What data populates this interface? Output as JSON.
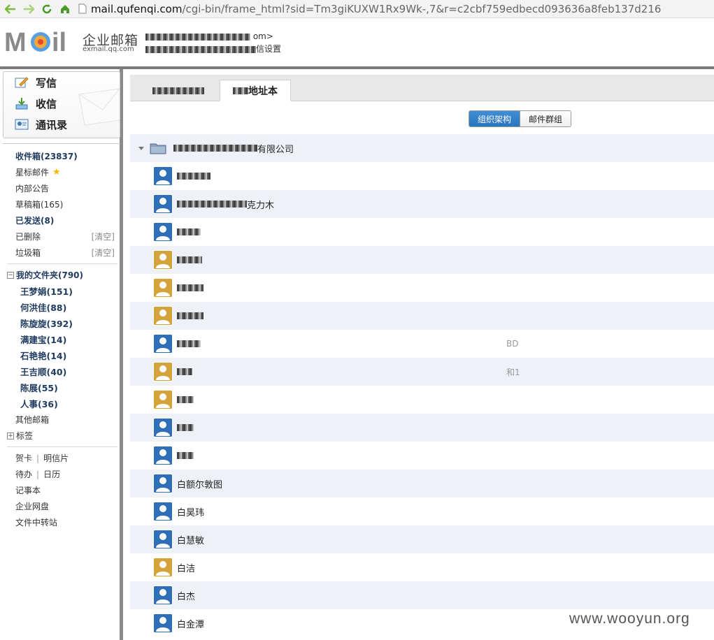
{
  "browser": {
    "url_host": "mail.qufenqi.com",
    "url_path": "/cgi-bin/frame_html?sid=Tm3giKUXW1Rx9Wk-,7&r=c2cbf759edbecd093636a8feb137d216"
  },
  "header": {
    "brand_name": "企业邮箱",
    "brand_domain": "exmail.qq.com",
    "account_suffix": "om>",
    "settings_suffix": "信设置"
  },
  "quick_actions": {
    "compose": "写信",
    "receive": "收信",
    "contacts": "通讯录"
  },
  "folders": {
    "inbox": "收件箱(23837)",
    "starred": "星标邮件",
    "announcements": "内部公告",
    "drafts": "草稿箱(165)",
    "sent": "已发送(8)",
    "deleted": "已删除",
    "spam": "垃圾箱",
    "clear_label": "[清空]",
    "my_folders": "我的文件夹(790)",
    "subfolders": [
      "王梦娟(151)",
      "何洪佳(88)",
      "陈旋旋(392)",
      "满建宝(14)",
      "石艳艳(14)",
      "王吉顺(40)",
      "陈展(55)",
      "人事(36)"
    ],
    "other_mailboxes": "其他邮箱",
    "tags": "标签"
  },
  "tools": {
    "card": "贺卡",
    "postcard": "明信片",
    "todo": "待办",
    "calendar": "日历",
    "notes": "记事本",
    "disk": "企业网盘",
    "transfer": "文件中转站"
  },
  "main": {
    "tab_personal": "",
    "tab_company": "地址本",
    "view_org": "组织架构",
    "view_groups": "邮件群组",
    "org_name": "有限公司",
    "contacts": [
      {
        "name": "",
        "dept": "",
        "avatar": "male"
      },
      {
        "name": "克力木",
        "dept": "",
        "avatar": "male"
      },
      {
        "name": "",
        "dept": "",
        "avatar": "male"
      },
      {
        "name": "",
        "dept": "",
        "avatar": "female"
      },
      {
        "name": "",
        "dept": "",
        "avatar": "female"
      },
      {
        "name": "",
        "dept": "",
        "avatar": "female"
      },
      {
        "name": "",
        "dept": "BD",
        "avatar": "male"
      },
      {
        "name": "",
        "dept": "和1",
        "avatar": "female"
      },
      {
        "name": "",
        "dept": "",
        "avatar": "female"
      },
      {
        "name": "",
        "dept": "",
        "avatar": "male"
      },
      {
        "name": "",
        "dept": "",
        "avatar": "male"
      },
      {
        "name": "白额尔敦图",
        "dept": "",
        "avatar": "male"
      },
      {
        "name": "白昊玮",
        "dept": "",
        "avatar": "male"
      },
      {
        "name": "白慧敏",
        "dept": "",
        "avatar": "male"
      },
      {
        "name": "白洁",
        "dept": "",
        "avatar": "female"
      },
      {
        "name": "白杰",
        "dept": "",
        "avatar": "male"
      },
      {
        "name": "白金潭",
        "dept": "",
        "avatar": "male"
      }
    ]
  },
  "watermark": "www.wooyun.org",
  "colors": {
    "accent_blue": "#2a76be",
    "row_alt": "#eef2f8",
    "avatar_male": "#2f6fb7",
    "avatar_female": "#d4a33a",
    "star": "#f5b800"
  }
}
